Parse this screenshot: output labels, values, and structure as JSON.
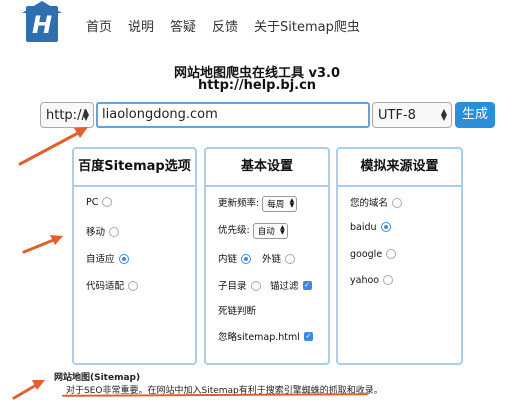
{
  "nav": {
    "items": [
      "首页",
      "说明",
      "答疑",
      "反馈",
      "关于Sitemap爬虫"
    ]
  },
  "header": {
    "title": "网站地图爬虫在线工具 v3.0",
    "subtitle": "http://help.bj.cn"
  },
  "form": {
    "protocol": "http://",
    "url": "liaolongdong.com",
    "charset": "UTF-8",
    "submit_label": "生成"
  },
  "panels": {
    "sitemap": {
      "title": "百度Sitemap选项",
      "options": [
        {
          "label": "PC",
          "selected": false
        },
        {
          "label": "移动",
          "selected": false
        },
        {
          "label": "自适应",
          "selected": true
        },
        {
          "label": "代码适配",
          "selected": false
        }
      ]
    },
    "basic": {
      "title": "基本设置",
      "freq_label": "更新频率:",
      "freq_value": "每周",
      "priority_label": "优先级:",
      "priority_value": "自动",
      "inner_link": "内链",
      "outer_link": "外链",
      "subdir": "子目录",
      "anchor_filter": "锚过滤",
      "dead_link": "死链判断",
      "ignore_sitemap": "忽略sitemap.html"
    },
    "source": {
      "title": "模拟来源设置",
      "options": [
        {
          "label": "您的域名",
          "selected": false
        },
        {
          "label": "baidu",
          "selected": true
        },
        {
          "label": "google",
          "selected": false
        },
        {
          "label": "yahoo",
          "selected": false
        }
      ]
    }
  },
  "footer": {
    "title": "网站地图(Sitemap)",
    "line1": "对于SEO非常重要。在网站中加入Sitemap有利于搜索引擎蜘蛛的抓取和收录。"
  },
  "colors": {
    "accent": "#2a8fd8",
    "panel_border": "#a9cdea",
    "annotation": "#e06030"
  }
}
